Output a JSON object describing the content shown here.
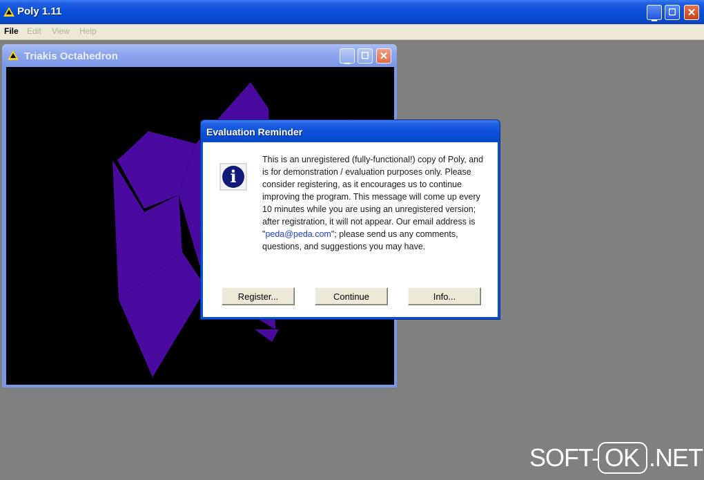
{
  "app": {
    "title": "Poly 1.11",
    "menu": [
      {
        "label": "File",
        "enabled": true
      },
      {
        "label": "Edit",
        "enabled": false
      },
      {
        "label": "View",
        "enabled": false
      },
      {
        "label": "Help",
        "enabled": false
      }
    ]
  },
  "child_window": {
    "title": "Triakis Octahedron",
    "shape_color": "#4a0aa0"
  },
  "dialog": {
    "title": "Evaluation Reminder",
    "message_before_email": "This is an unregistered (fully-functional!) copy of Poly, and is for demonstration / evaluation purposes only. Please consider registering, as it encourages us to continue improving the program. This message will come up every 10 minutes while you are using an unregistered version; after registration, it will not appear. Our email address is \"",
    "email": "peda@peda.com",
    "message_after_email": "\"; please send us any comments, questions, and suggestions you may have.",
    "buttons": {
      "register": "Register...",
      "continue": "Continue",
      "info": "Info..."
    }
  },
  "watermark": {
    "left": "SOFT-",
    "boxed": "OK",
    "right": ".NET"
  },
  "colors": {
    "xp_blue": "#0a4fd8",
    "desktop_gray": "#808080",
    "inactive_blue": "#7c97e8"
  }
}
